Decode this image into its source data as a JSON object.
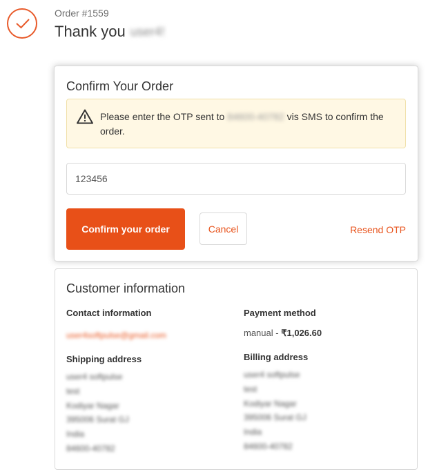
{
  "header": {
    "order_number": "Order #1559",
    "thank_you": "Thank you",
    "customer_name": "user4!"
  },
  "confirm": {
    "title": "Confirm Your Order",
    "notice_before": "Please enter the OTP sent to ",
    "masked_phone": "84600-40782",
    "notice_after": " vis SMS to confirm the order.",
    "otp_value": "123456",
    "confirm_button": "Confirm your order",
    "cancel_button": "Cancel",
    "resend_link": "Resend OTP"
  },
  "customer": {
    "title": "Customer information",
    "contact_heading": "Contact information",
    "email": "user4softpulse@gmail.com",
    "payment_heading": "Payment method",
    "payment_method": "manual",
    "payment_separator": " - ",
    "payment_amount": "₹1,026.60",
    "shipping_heading": "Shipping address",
    "shipping_lines": [
      "user4 softpulse",
      "test",
      "Kodiyar Nagar",
      "395006 Surat GJ",
      "India",
      "84600-40782"
    ],
    "billing_heading": "Billing address",
    "billing_lines": [
      "user4 softpulse",
      "test",
      "Kodiyar Nagar",
      "395006 Surat GJ",
      "India",
      "84600-40782"
    ]
  },
  "colors": {
    "accent": "#e85018",
    "notice_background": "#fff8e4"
  },
  "icons": {
    "order_status": "checkmark-circle-icon",
    "notice": "warning-triangle-icon"
  }
}
